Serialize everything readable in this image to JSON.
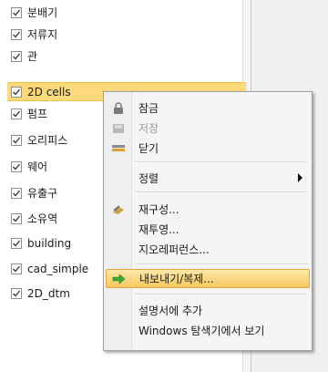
{
  "layers": [
    {
      "label": "분배기",
      "checked": true
    },
    {
      "label": "저류지",
      "checked": true
    },
    {
      "label": "관",
      "checked": true
    },
    {
      "label": "2D cells",
      "checked": true,
      "selected": true
    },
    {
      "label": "펌프",
      "checked": true
    },
    {
      "label": "오리피스",
      "checked": true
    },
    {
      "label": "웨어",
      "checked": true
    },
    {
      "label": "유출구",
      "checked": true
    },
    {
      "label": "소유역",
      "checked": true
    },
    {
      "label": "building",
      "checked": true
    },
    {
      "label": "cad_simple",
      "checked": true
    },
    {
      "label": "2D_dtm",
      "checked": true
    }
  ],
  "context_menu": {
    "lock": "잠금",
    "save": "저장",
    "close": "닫기",
    "sort": "정렬",
    "reconfigure": "재구성...",
    "reproject": "재투영...",
    "georeference": "지오레퍼런스...",
    "export_copy": "내보내기/복제...",
    "add_to_description": "설명서에 추가",
    "show_in_explorer": "Windows 탐색기에서 보기"
  },
  "colors": {
    "selection": "#fcd97a",
    "menu_highlight": "#f7c860"
  }
}
